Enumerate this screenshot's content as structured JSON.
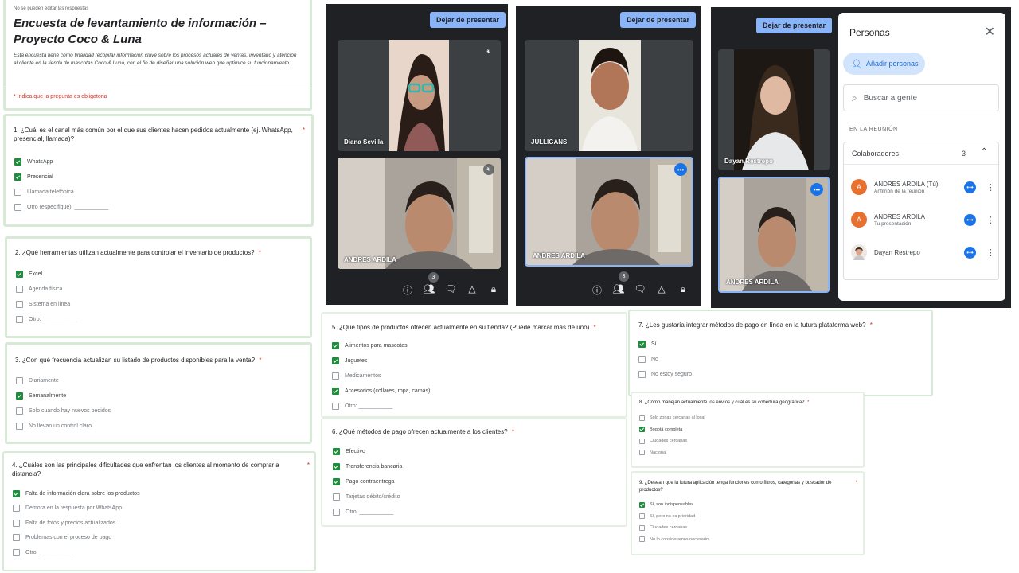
{
  "form": {
    "header": {
      "notice": "No se pueden editar las respuestas",
      "title": "Encuesta de levantamiento de información – Proyecto Coco & Luna",
      "description": "Esta encuesta tiene como finalidad recopilar información clave sobre los procesos actuales de ventas, inventario y atención al cliente en la tienda de mascotas Coco & Luna, con el fin de diseñar una solución web que optimice su funcionamiento.",
      "required_note": "* Indica que la pregunta es obligatoria"
    },
    "q1": {
      "title": "1. ¿Cuál es el canal más común por el que sus clientes hacen pedidos actualmente (ej. WhatsApp, presencial, llamada)?",
      "req": "*",
      "options": [
        {
          "label": "WhatsApp",
          "checked": true
        },
        {
          "label": "Presencial",
          "checked": true
        },
        {
          "label": "Llamada telefónica",
          "checked": false
        },
        {
          "label": "Otro (especifique): ___________",
          "checked": false
        }
      ]
    },
    "q2": {
      "title": "2. ¿Qué herramientas utilizan actualmente para controlar el inventario de productos?",
      "req": "*",
      "options": [
        {
          "label": "Excel",
          "checked": true
        },
        {
          "label": "Agenda física",
          "checked": false
        },
        {
          "label": "Sistema en línea",
          "checked": false
        },
        {
          "label": "Otro: ___________",
          "checked": false
        }
      ]
    },
    "q3": {
      "title": "3. ¿Con qué frecuencia actualizan su listado de productos disponibles para la venta?",
      "req": "*",
      "options": [
        {
          "label": "Diariamente",
          "checked": false
        },
        {
          "label": "Semanalmente",
          "checked": true
        },
        {
          "label": "Solo cuando hay nuevos pedidos",
          "checked": false
        },
        {
          "label": "No llevan un control claro",
          "checked": false
        }
      ]
    },
    "q4": {
      "title": "4. ¿Cuáles son las principales dificultades que enfrentan los clientes al momento de comprar a distancia?",
      "req": "*",
      "options": [
        {
          "label": "Falta de información clara sobre los productos",
          "checked": true
        },
        {
          "label": "Demora en la respuesta por WhatsApp",
          "checked": false
        },
        {
          "label": "Falta de fotos y precios actualizados",
          "checked": false
        },
        {
          "label": "Problemas con el proceso de pago",
          "checked": false
        },
        {
          "label": "Otro: ___________",
          "checked": false
        }
      ]
    },
    "q5": {
      "title": "5. ¿Qué tipos de productos ofrecen actualmente en su tienda? (Puede marcar más de uno)",
      "req": "*",
      "options": [
        {
          "label": "Alimentos para mascotas",
          "checked": true
        },
        {
          "label": "Juguetes",
          "checked": true
        },
        {
          "label": "Medicamentos",
          "checked": false
        },
        {
          "label": "Accesorios (collares, ropa, camas)",
          "checked": true
        },
        {
          "label": "Otro: ___________",
          "checked": false
        }
      ]
    },
    "q6": {
      "title": "6. ¿Qué métodos de pago ofrecen actualmente a los clientes?",
      "req": "*",
      "options": [
        {
          "label": "Efectivo",
          "checked": true
        },
        {
          "label": "Transferencia bancaria",
          "checked": true
        },
        {
          "label": "Pago contraentrega",
          "checked": true
        },
        {
          "label": "Tarjetas débito/crédito",
          "checked": false
        },
        {
          "label": "Otro: ___________",
          "checked": false
        }
      ]
    },
    "q7": {
      "title": "7. ¿Les gustaría integrar métodos de pago en línea en la futura plataforma web?",
      "req": "*",
      "options": [
        {
          "label": "Sí",
          "checked": true
        },
        {
          "label": "No",
          "checked": false
        },
        {
          "label": "No estoy seguro",
          "checked": false
        }
      ]
    },
    "q8": {
      "title": "8. ¿Cómo manejan actualmente los envíos y cuál es su cobertura geográfica?",
      "req": "*",
      "options": [
        {
          "label": "Solo zonas cercanas al local",
          "checked": false
        },
        {
          "label": "Bogotá completa",
          "checked": true
        },
        {
          "label": "Ciudades cercanas",
          "checked": false
        },
        {
          "label": "Nacional",
          "checked": false
        }
      ]
    },
    "q9": {
      "title": "9. ¿Desean que la futura aplicación tenga funciones como filtros, categorías y buscador de productos?",
      "req": "*",
      "options": [
        {
          "label": "Sí, son indispensables",
          "checked": true
        },
        {
          "label": "Sí, pero no es prioridad",
          "checked": false
        },
        {
          "label": "Ciudades cercanas",
          "checked": false
        },
        {
          "label": "No lo consideramos necesario",
          "checked": false
        }
      ]
    }
  },
  "meet": {
    "present_label": "Dejar de presentar",
    "participant_count": "3",
    "panel1": {
      "top_name": "Diana Sevilla",
      "bottom_name": "ANDRES ARDILA"
    },
    "panel2": {
      "top_name": "JULLIGANS",
      "bottom_name": "ANDRES ARDILA"
    },
    "panel3": {
      "top_name": "Dayan Restrepo",
      "bottom_name": "ANDRES ARDILA"
    },
    "icons": [
      "info-icon",
      "people-icon",
      "chat-icon",
      "activities-icon",
      "lock-icon"
    ],
    "colors": {
      "background": "#202124",
      "accent": "#8ab4f8",
      "blue": "#1a73e8"
    }
  },
  "people_panel": {
    "title": "Personas",
    "add_label": "Añadir personas",
    "search_placeholder": "Buscar a gente",
    "section_label": "EN LA REUNIÓN",
    "group_label": "Colaboradores",
    "group_count": "3",
    "members": [
      {
        "initial": "A",
        "name": "ANDRES ARDILA (Tú)",
        "sub": "Anfitrión de la reunión"
      },
      {
        "initial": "A",
        "name": "ANDRES ARDILA",
        "sub": "Tu presentación"
      },
      {
        "initial": "",
        "name": "Dayan Restrepo",
        "sub": ""
      }
    ]
  }
}
